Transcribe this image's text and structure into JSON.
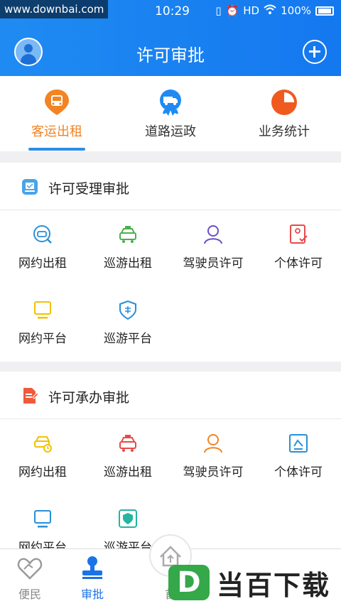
{
  "status_bar": {
    "watermark": "www.downbai.com",
    "time": "10:29",
    "hd": "HD",
    "battery": "100%"
  },
  "header": {
    "title": "许可审批",
    "avatar_icon": "user-avatar-icon",
    "add_icon": "plus-circle-icon"
  },
  "tabs": [
    {
      "label": "客运出租",
      "icon": "bus-pin-icon",
      "color": "#f28424",
      "active": true
    },
    {
      "label": "道路运政",
      "icon": "truck-badge-icon",
      "color": "#1f8bf2",
      "active": false
    },
    {
      "label": "业务统计",
      "icon": "pie-chart-icon",
      "color": "#f05a1e",
      "active": false
    }
  ],
  "section1": {
    "title": "许可受理审批",
    "items": [
      {
        "label": "网约出租",
        "icon": "taxi-search-icon",
        "color": "#2a8fd6"
      },
      {
        "label": "巡游出租",
        "icon": "taxi-icon",
        "color": "#4caf50"
      },
      {
        "label": "驾驶员许可",
        "icon": "driver-icon",
        "color": "#6a4fc8"
      },
      {
        "label": "个体许可",
        "icon": "id-check-icon",
        "color": "#e84a4a"
      },
      {
        "label": "网约平台",
        "icon": "monitor-icon",
        "color": "#f2c200"
      },
      {
        "label": "巡游平台",
        "icon": "shield-enterprise-icon",
        "color": "#2a8fd6"
      }
    ]
  },
  "section2": {
    "title": "许可承办审批",
    "items": [
      {
        "label": "网约出租",
        "icon": "car-clock-icon",
        "color": "#f2c200"
      },
      {
        "label": "巡游出租",
        "icon": "taxi-icon",
        "color": "#e84a4a"
      },
      {
        "label": "驾驶员许可",
        "icon": "driver-icon",
        "color": "#f28424"
      },
      {
        "label": "个体许可",
        "icon": "photo-id-icon",
        "color": "#2a8fd6"
      },
      {
        "label": "网约平台",
        "icon": "monitor-icon",
        "color": "#2a8fd6"
      },
      {
        "label": "巡游平台",
        "icon": "shield-check-icon",
        "color": "#26b5a0"
      }
    ]
  },
  "bottom_nav": [
    {
      "label": "便民",
      "icon": "heart-hands-icon",
      "active": false
    },
    {
      "label": "审批",
      "icon": "stamp-icon",
      "active": true
    },
    {
      "label": "首",
      "icon": "home-icon",
      "active": false
    }
  ],
  "watermark_logo": {
    "letter": "D",
    "text": "当百下载"
  }
}
